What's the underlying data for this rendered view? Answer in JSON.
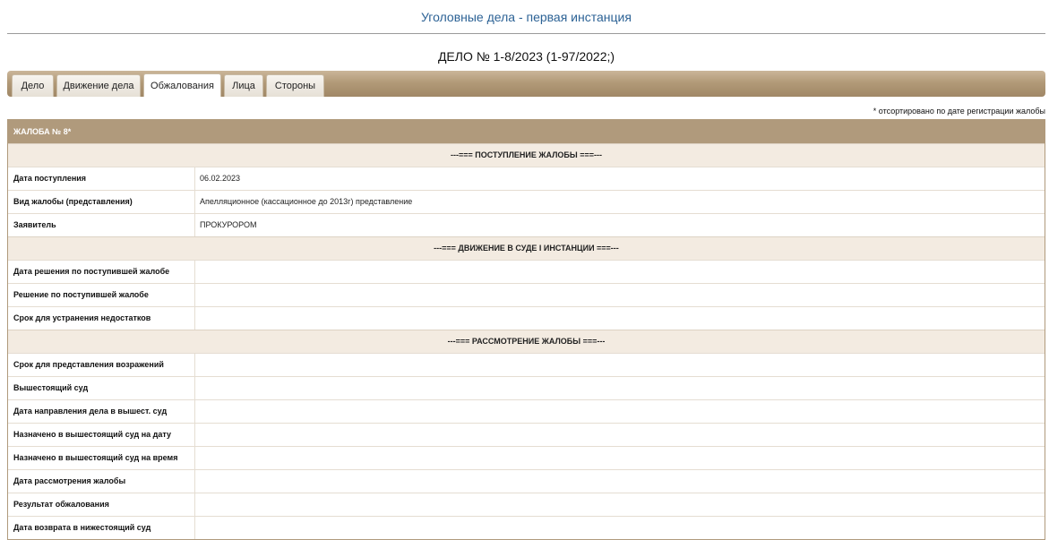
{
  "header": {
    "title": "Уголовные дела - первая инстанция",
    "case_number": "ДЕЛО № 1-8/2023 (1-97/2022;)"
  },
  "tabs": [
    {
      "label": "Дело",
      "active": false
    },
    {
      "label": "Движение дела",
      "active": false
    },
    {
      "label": "Обжалования",
      "active": true
    },
    {
      "label": "Лица",
      "active": false
    },
    {
      "label": "Стороны",
      "active": false
    }
  ],
  "sort_note": "* отсортировано по дате регистрации жалобы",
  "complaint": {
    "header": "ЖАЛОБА № 8*",
    "sections": [
      {
        "title": "---=== ПОСТУПЛЕНИЕ ЖАЛОБЫ ===---",
        "rows": [
          {
            "label": "Дата поступления",
            "value": "06.02.2023"
          },
          {
            "label": "Вид жалобы (представления)",
            "value": "Апелляционное (кассационное до 2013г) представление"
          },
          {
            "label": "Заявитель",
            "value": "ПРОКУРОРОМ"
          }
        ]
      },
      {
        "title": "---=== ДВИЖЕНИЕ В СУДЕ I ИНСТАНЦИИ ===---",
        "rows": [
          {
            "label": "Дата решения по поступившей жалобе",
            "value": ""
          },
          {
            "label": "Решение по поступившей жалобе",
            "value": ""
          },
          {
            "label": "Срок для устранения недостатков",
            "value": ""
          }
        ]
      },
      {
        "title": "---=== РАССМОТРЕНИЕ ЖАЛОБЫ ===---",
        "rows": [
          {
            "label": "Срок для представления возражений",
            "value": ""
          },
          {
            "label": "Вышестоящий суд",
            "value": ""
          },
          {
            "label": "Дата направления дела в вышест. суд",
            "value": ""
          },
          {
            "label": "Назначено в вышестоящий суд на дату",
            "value": ""
          },
          {
            "label": "Назначено в вышестоящий суд на время",
            "value": ""
          },
          {
            "label": "Дата рассмотрения жалобы",
            "value": ""
          },
          {
            "label": "Результат обжалования",
            "value": ""
          },
          {
            "label": "Дата возврата в нижестоящий суд",
            "value": ""
          }
        ]
      }
    ]
  }
}
